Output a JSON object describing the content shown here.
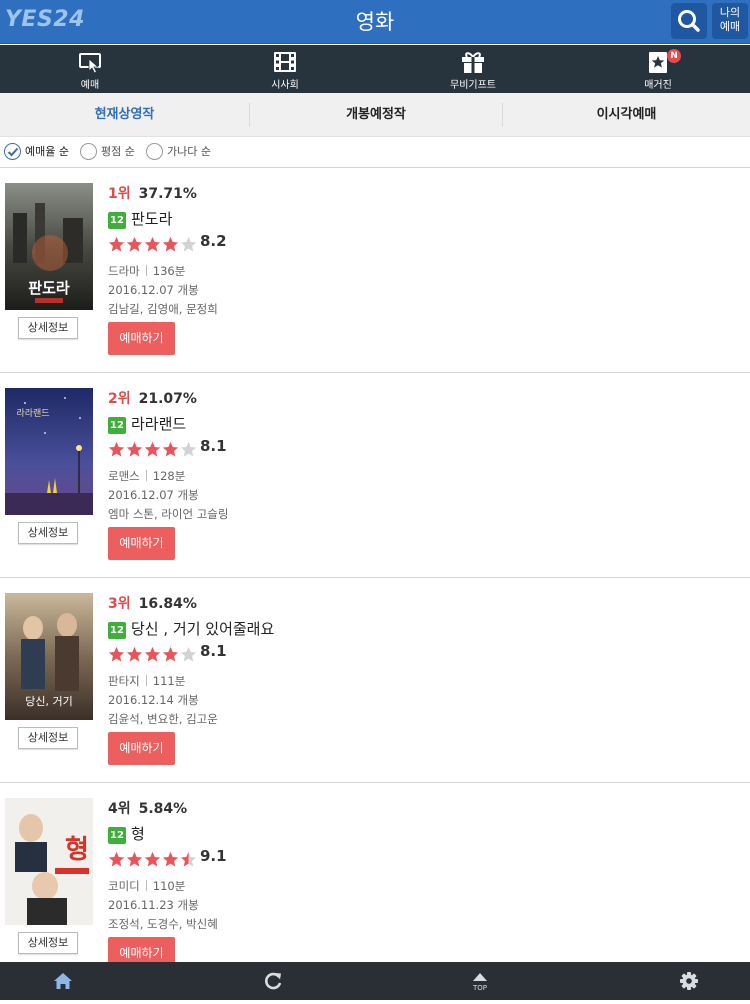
{
  "header": {
    "logo": "YES24",
    "title": "영화",
    "my_button": [
      "나의",
      "예매"
    ]
  },
  "icon_nav": [
    {
      "label": "예매",
      "icon": "ticket-cursor-icon"
    },
    {
      "label": "시사회",
      "icon": "film-icon"
    },
    {
      "label": "무비기프트",
      "icon": "gift-icon"
    },
    {
      "label": "매거진",
      "icon": "magazine-star-icon",
      "badge": "N"
    }
  ],
  "tabs": [
    "현재상영작",
    "개봉예정작",
    "이시각예매"
  ],
  "sort": {
    "options": [
      "예매율 순",
      "평점 순",
      "가나다 순"
    ],
    "selected": 0
  },
  "movies": [
    {
      "rank": "1위",
      "rate": "37.71%",
      "age": "12",
      "title": "판도라",
      "stars": 4,
      "score": "8.2",
      "genre": "드라마",
      "runtime": "136분",
      "release": "2016.12.07 개봉",
      "cast": "김남길, 김영애, 문정희",
      "detail": "상세정보",
      "book": "예매하기",
      "rank_color": "red"
    },
    {
      "rank": "2위",
      "rate": "21.07%",
      "age": "12",
      "title": "라라랜드",
      "stars": 4,
      "score": "8.1",
      "genre": "로맨스",
      "runtime": "128분",
      "release": "2016.12.07 개봉",
      "cast": "엠마 스톤, 라이언 고슬링",
      "detail": "상세정보",
      "book": "예매하기",
      "rank_color": "red"
    },
    {
      "rank": "3위",
      "rate": "16.84%",
      "age": "12",
      "title": "당신 , 거기 있어줄래요",
      "stars": 4,
      "score": "8.1",
      "genre": "판타지",
      "runtime": "111분",
      "release": "2016.12.14 개봉",
      "cast": "김윤석, 변요한, 김고운",
      "detail": "상세정보",
      "book": "예매하기",
      "rank_color": "red"
    },
    {
      "rank": "4위",
      "rate": "5.84%",
      "age": "12",
      "title": "형",
      "stars": 4.5,
      "score": "9.1",
      "genre": "코미디",
      "runtime": "110분",
      "release": "2016.11.23 개봉",
      "cast": "조정석, 도경수, 박신혜",
      "detail": "상세정보",
      "book": "예매하기",
      "rank_color": "dark"
    }
  ],
  "bottom_nav": [
    {
      "icon": "home-icon"
    },
    {
      "icon": "refresh-icon"
    },
    {
      "icon": "scroll-top-icon",
      "label": "TOP"
    },
    {
      "icon": "settings-gear-icon"
    }
  ],
  "colors": {
    "header_blue": "#2f6fbf",
    "icon_bar": "#27333d",
    "rank_red": "#e14a4a",
    "book_button": "#ed5f5f",
    "age_green": "#3fae3a",
    "star_red": "#e8555a"
  }
}
